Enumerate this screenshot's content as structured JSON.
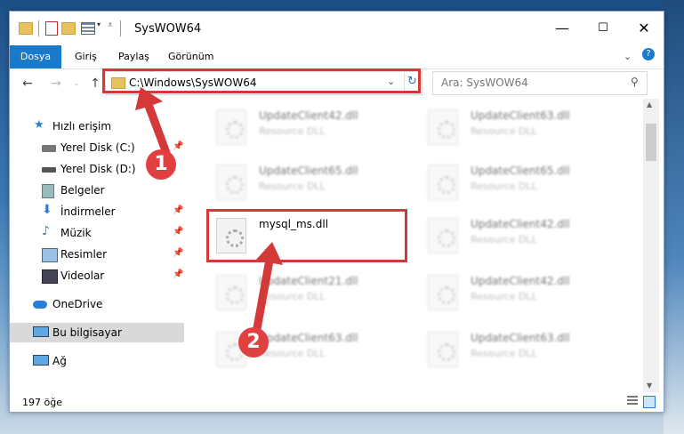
{
  "window": {
    "title": "SysWOW64"
  },
  "ribbon": {
    "tabs": [
      "Dosya",
      "Giriş",
      "Paylaş",
      "Görünüm"
    ]
  },
  "address": {
    "path": "C:\\Windows\\SysWOW64",
    "search_placeholder": "Ara: SysWOW64"
  },
  "sidebar": {
    "items": [
      {
        "label": "Hızlı erişim",
        "icon": "star-icon"
      },
      {
        "label": "Yerel Disk (C:)",
        "icon": "drive-icon"
      },
      {
        "label": "Yerel Disk (D:)",
        "icon": "drive-icon"
      },
      {
        "label": "Belgeler",
        "icon": "documents-icon"
      },
      {
        "label": "İndirmeler",
        "icon": "download-icon"
      },
      {
        "label": "Müzik",
        "icon": "music-icon"
      },
      {
        "label": "Resimler",
        "icon": "pictures-icon"
      },
      {
        "label": "Videolar",
        "icon": "video-icon"
      },
      {
        "label": "OneDrive",
        "icon": "cloud-icon"
      },
      {
        "label": "Bu bilgisayar",
        "icon": "computer-icon"
      },
      {
        "label": "Ağ",
        "icon": "network-icon"
      }
    ]
  },
  "files": [
    {
      "name": "UpdateClient42.dll",
      "desc": "Resource DLL"
    },
    {
      "name": "UpdateClient63.dll",
      "desc": "Resource DLL"
    },
    {
      "name": "UpdateClient65.dll",
      "desc": "Resource DLL"
    },
    {
      "name": "UpdateClient65.dll",
      "desc": "Resource DLL"
    },
    {
      "name": "mysql_ms.dll",
      "desc": ""
    },
    {
      "name": "UpdateClient42.dll",
      "desc": "Resource DLL"
    },
    {
      "name": "UpdateClient21.dll",
      "desc": "Resource DLL"
    },
    {
      "name": "UpdateClient42.dll",
      "desc": "Resource DLL"
    },
    {
      "name": "UpdateClient63.dll",
      "desc": "Resource DLL"
    },
    {
      "name": "UpdateClient63.dll",
      "desc": "Resource DLL"
    }
  ],
  "status": {
    "count": "197 öğe"
  },
  "annotations": {
    "step1": "1",
    "step2": "2"
  },
  "colors": {
    "accent": "#1979ca",
    "highlight": "#d43838"
  }
}
